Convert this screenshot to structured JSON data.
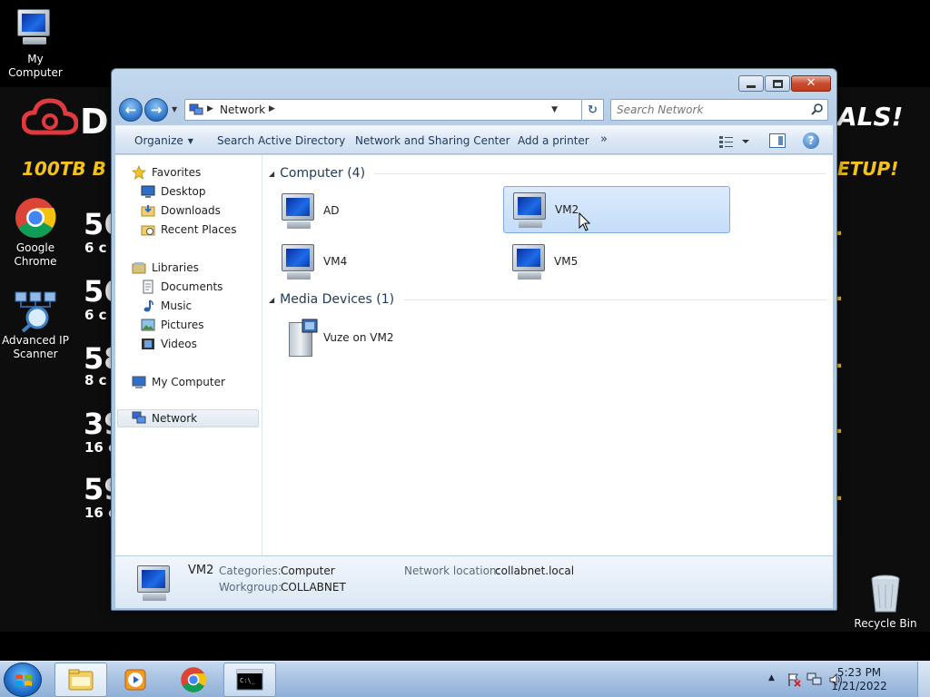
{
  "wallpaper": {
    "brand": "D",
    "deals": "ALS!",
    "hdd": "100TB B",
    "setup": "ETUP!",
    "rows": [
      {
        "num": "56",
        "sub": "6 c"
      },
      {
        "num": "56",
        "sub": "6 c"
      },
      {
        "num": "58",
        "sub": "8 c"
      },
      {
        "num": "39",
        "sub": "16 c"
      },
      {
        "num": "59",
        "sub": "16 c"
      }
    ],
    "dot": "."
  },
  "desktop": {
    "icons": [
      {
        "name": "my-computer",
        "label": "My Computer"
      },
      {
        "name": "google-chrome",
        "label": "Google Chrome"
      },
      {
        "name": "advanced-ip-scanner",
        "label": "Advanced IP Scanner"
      },
      {
        "name": "recycle-bin",
        "label": "Recycle Bin"
      }
    ]
  },
  "window": {
    "address": {
      "crumb": "Network"
    },
    "search": {
      "placeholder": "Search Network"
    },
    "toolbar": {
      "organize": "Organize",
      "search_ad": "Search Active Directory",
      "network_center": "Network and Sharing Center",
      "add_printer": "Add a printer",
      "more": "»"
    },
    "nav": {
      "favorites": "Favorites",
      "desktop": "Desktop",
      "downloads": "Downloads",
      "recent": "Recent Places",
      "libraries": "Libraries",
      "documents": "Documents",
      "music": "Music",
      "pictures": "Pictures",
      "videos": "Videos",
      "my_computer": "My Computer",
      "network": "Network"
    },
    "groups": {
      "computer": "Computer (4)",
      "media": "Media Devices (1)"
    },
    "computers": [
      "AD",
      "VM2",
      "VM4",
      "VM5"
    ],
    "media_devices": [
      "Vuze on VM2"
    ],
    "details": {
      "name": "VM2",
      "categories_label": "Categories:",
      "categories_value": "Computer",
      "workgroup_label": "Workgroup:",
      "workgroup_value": "COLLABNET",
      "location_label": "Network location:",
      "location_value": "collabnet.local"
    }
  },
  "taskbar": {
    "time": "5:23 PM",
    "date": "1/21/2022",
    "cmd_icon_text": "C:\\_"
  },
  "colors": {
    "accent": "#1d6be8",
    "wallpaper_yellow": "#f4c21a",
    "selection": "#c4ddfa"
  }
}
